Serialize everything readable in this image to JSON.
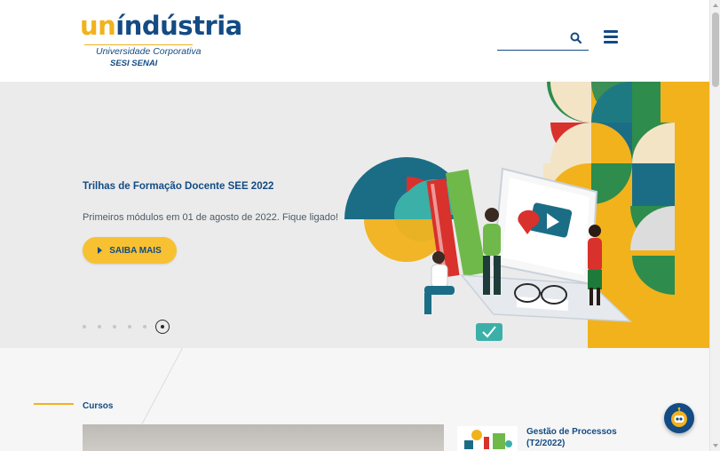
{
  "brand": {
    "logo_accent": "un",
    "logo_rest": "índústria",
    "subtitle": "Universidade Corporativa",
    "org": "SESI SENAI",
    "colors": {
      "navy": "#134b84",
      "yellow": "#f2b21c"
    }
  },
  "header": {
    "search": {
      "placeholder": "",
      "icon": "search-icon"
    },
    "menu_icon": "hamburger-menu-icon"
  },
  "banner": {
    "title": "Trilhas de Formação Docente SEE 2022",
    "subtitle": "Primeiros módulos em 01 de agosto de 2022. Fique ligado!",
    "cta_label": "SAIBA MAIS",
    "slide_count": 6,
    "active_slide": 6
  },
  "cursos": {
    "label": "Cursos",
    "items": [
      {
        "title": "Gestão de Processos (T2/2022)"
      }
    ]
  },
  "chat": {
    "icon": "chatbot-icon"
  }
}
